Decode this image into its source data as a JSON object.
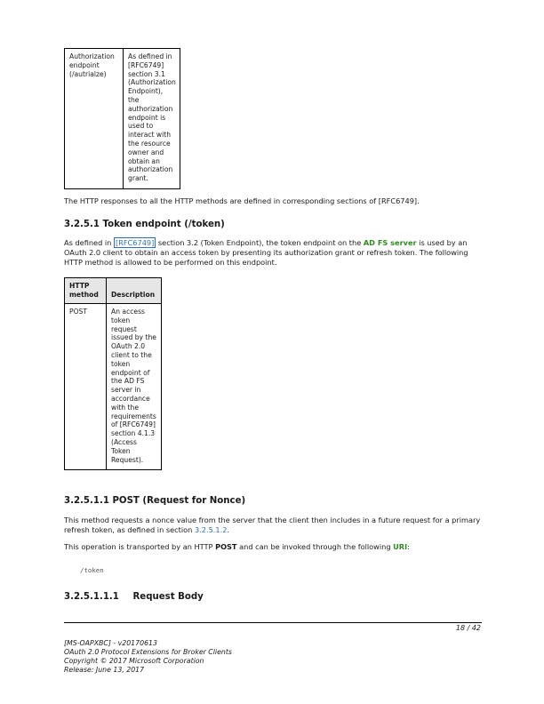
{
  "table1": {
    "rows": [
      {
        "col1": "Authorization endpoint (/autrialze)",
        "col2": "As defined in [RFC6749] section 3.1 (Authorization Endpoint), the authorization endpoint is used to interact with the resource owner and obtain an authorization grant."
      }
    ]
  },
  "para_http_responses": "The HTTP responses to all the HTTP methods are defined in corresponding sections of [RFC6749].",
  "heading_token_endpoint": {
    "number": "3.2.5.1",
    "title": "Token endpoint (/token)"
  },
  "para_token": {
    "t1": "As defined in ",
    "link1": "[RFC6749]",
    "t2": " section 3.2 (Token Endpoint), the token endpoint on the ",
    "term1": "AD FS server",
    "t3": " is used by an OAuth 2.0 client to obtain an access token by presenting its authorization grant or refresh token. The following HTTP method is allowed to be performed on this endpoint."
  },
  "table2": {
    "header": {
      "col1": "HTTP method",
      "col2": "Description"
    },
    "rows": [
      {
        "col1": "POST",
        "col2": "An access token request issued by the OAuth 2.0 client to the token endpoint of the AD FS server in accordance with the requirements of [RFC6749] section 4.1.3 (Access Token Request)."
      }
    ]
  },
  "heading_post": "3.2.5.1.1 POST (Request for Nonce)",
  "para_method": {
    "t1": "This method requests a nonce value from the server that the client then includes in a future request for a primary refresh token, as defined in section ",
    "link": "3.2.5.1.2",
    "t2": "."
  },
  "para_transport": {
    "t1": "This operation is transported by an HTTP ",
    "bold": "POST",
    "t2": " and can be invoked through the following ",
    "term": "URI",
    "t3": ":"
  },
  "code_uri": "/token",
  "heading_request_body": {
    "number": "3.2.5.1.1.1",
    "title": "Request Body"
  },
  "page_number": "18 / 42",
  "footer": {
    "line1": "[MS-OAPXBC] - v20170613",
    "line2": "OAuth 2.0 Protocol Extensions for Broker Clients",
    "line3": "Copyright © 2017 Microsoft Corporation",
    "line4": "Release: June 13, 2017"
  },
  "colors": {
    "link": "#2f6fb3",
    "term": "#2e8b1f",
    "header_fill": "#e6e6e6"
  }
}
